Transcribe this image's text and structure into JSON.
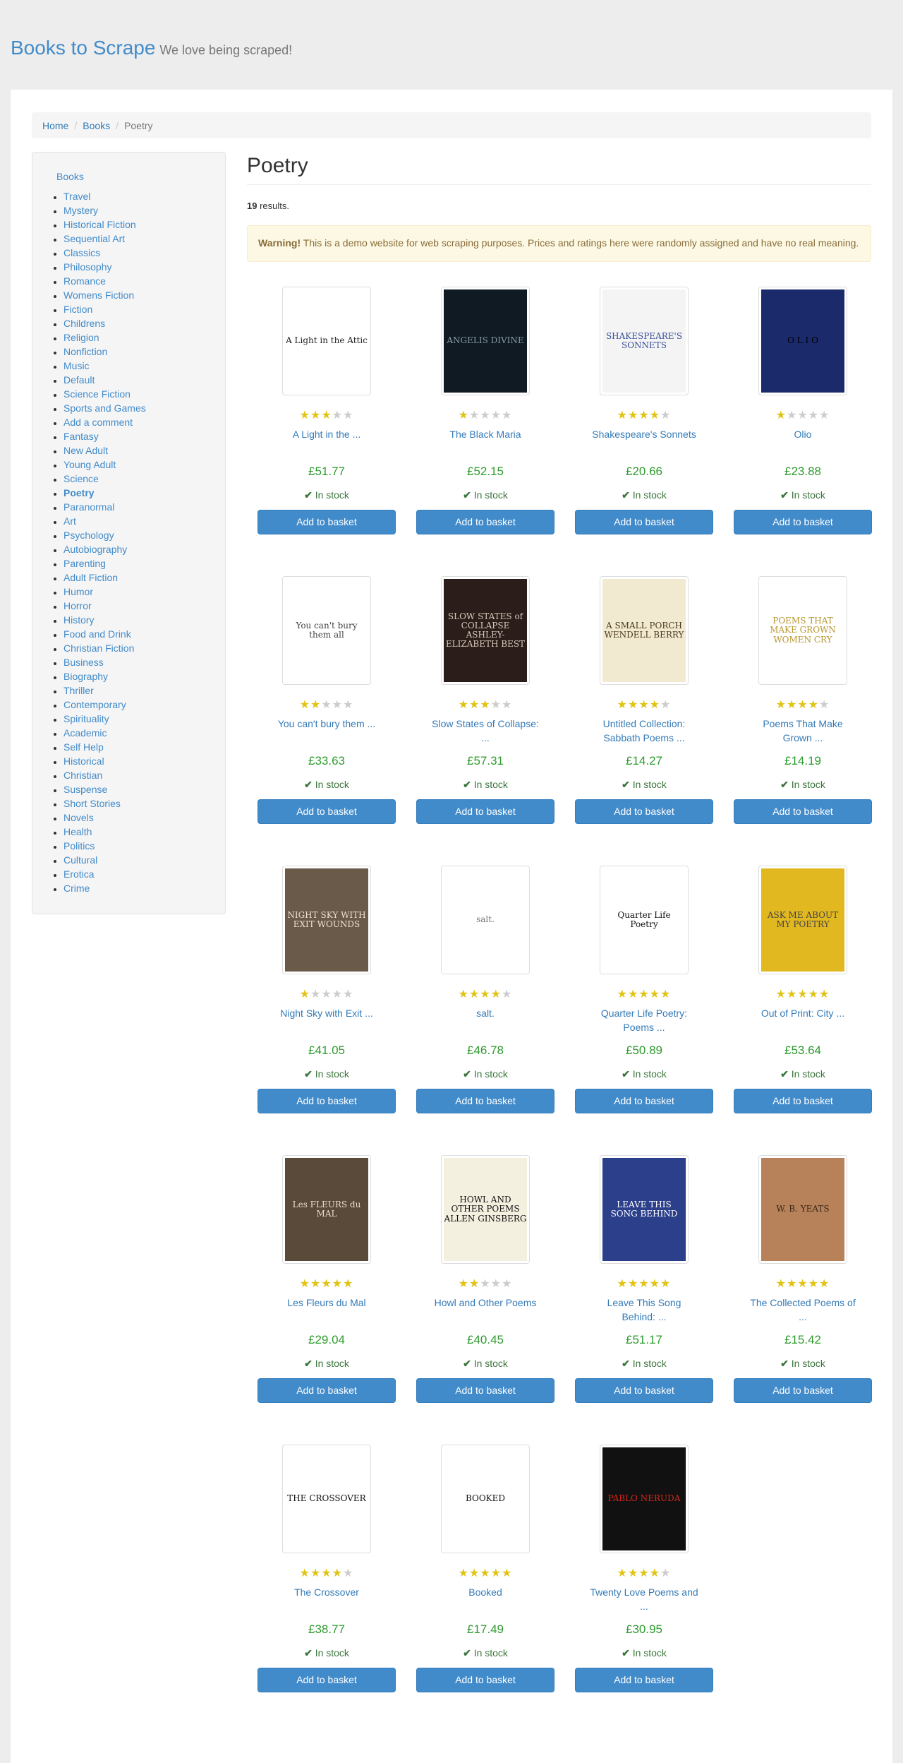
{
  "header": {
    "brand": "Books to Scrape",
    "tagline": "We love being scraped!"
  },
  "breadcrumb": [
    "Home",
    "Books",
    "Poetry"
  ],
  "sidebar": {
    "root": "Books",
    "current": "Poetry",
    "categories": [
      "Travel",
      "Mystery",
      "Historical Fiction",
      "Sequential Art",
      "Classics",
      "Philosophy",
      "Romance",
      "Womens Fiction",
      "Fiction",
      "Childrens",
      "Religion",
      "Nonfiction",
      "Music",
      "Default",
      "Science Fiction",
      "Sports and Games",
      "Add a comment",
      "Fantasy",
      "New Adult",
      "Young Adult",
      "Science",
      "Poetry",
      "Paranormal",
      "Art",
      "Psychology",
      "Autobiography",
      "Parenting",
      "Adult Fiction",
      "Humor",
      "Horror",
      "History",
      "Food and Drink",
      "Christian Fiction",
      "Business",
      "Biography",
      "Thriller",
      "Contemporary",
      "Spirituality",
      "Academic",
      "Self Help",
      "Historical",
      "Christian",
      "Suspense",
      "Short Stories",
      "Novels",
      "Health",
      "Politics",
      "Cultural",
      "Erotica",
      "Crime"
    ]
  },
  "main": {
    "title": "Poetry",
    "result_count": "19",
    "results_suffix": " results.",
    "warning_label": "Warning!",
    "warning_text": " This is a demo website for web scraping purposes. Prices and ratings here were randomly assigned and have no real meaning.",
    "stock_text": "In stock",
    "add_label": "Add to basket"
  },
  "books": [
    {
      "title": "A Light in the ...",
      "price": "£51.77",
      "rating": 3,
      "cover_bg": "#ffffff",
      "cover_fg": "#222222",
      "cover_text": "A Light in the Attic"
    },
    {
      "title": "The Black Maria",
      "price": "£52.15",
      "rating": 1,
      "cover_bg": "#0f1a22",
      "cover_fg": "#8899aa",
      "cover_text": "ANGELIS DIVINE"
    },
    {
      "title": "Shakespeare's Sonnets",
      "price": "£20.66",
      "rating": 4,
      "cover_bg": "#f4f4f4",
      "cover_fg": "#3a4f9a",
      "cover_text": "SHAKESPEARE'S SONNETS"
    },
    {
      "title": "Olio",
      "price": "£23.88",
      "rating": 1,
      "cover_bg": "#1b2a6b",
      "cover_fg": "#000000",
      "cover_text": "O L I O"
    },
    {
      "title": "You can't bury them ...",
      "price": "£33.63",
      "rating": 2,
      "cover_bg": "#ffffff",
      "cover_fg": "#444444",
      "cover_text": "You can't bury them all"
    },
    {
      "title": "Slow States of Collapse: ...",
      "price": "£57.31",
      "rating": 3,
      "cover_bg": "#2a1d1a",
      "cover_fg": "#d8c9b8",
      "cover_text": "SLOW STATES of COLLAPSE ASHLEY-ELIZABETH BEST"
    },
    {
      "title": "Untitled Collection: Sabbath Poems ...",
      "price": "£14.27",
      "rating": 4,
      "cover_bg": "#f2ead0",
      "cover_fg": "#4a3a20",
      "cover_text": "A SMALL PORCH WENDELL BERRY"
    },
    {
      "title": "Poems That Make Grown ...",
      "price": "£14.19",
      "rating": 4,
      "cover_bg": "#ffffff",
      "cover_fg": "#b8962e",
      "cover_text": "POEMS THAT MAKE GROWN WOMEN CRY"
    },
    {
      "title": "Night Sky with Exit ...",
      "price": "£41.05",
      "rating": 1,
      "cover_bg": "#6a5a4a",
      "cover_fg": "#f0e0d0",
      "cover_text": "NIGHT SKY WITH EXIT WOUNDS"
    },
    {
      "title": "salt.",
      "price": "£46.78",
      "rating": 4,
      "cover_bg": "#ffffff",
      "cover_fg": "#777777",
      "cover_text": "salt."
    },
    {
      "title": "Quarter Life Poetry: Poems ...",
      "price": "£50.89",
      "rating": 5,
      "cover_bg": "#ffffff",
      "cover_fg": "#111111",
      "cover_text": "Quarter Life Poetry"
    },
    {
      "title": "Out of Print: City ...",
      "price": "£53.64",
      "rating": 5,
      "cover_bg": "#e2b820",
      "cover_fg": "#444444",
      "cover_text": "ASK ME ABOUT MY POETRY"
    },
    {
      "title": "Les Fleurs du Mal",
      "price": "£29.04",
      "rating": 5,
      "cover_bg": "#5a4a3a",
      "cover_fg": "#e8dcc8",
      "cover_text": "Les FLEURS du MAL"
    },
    {
      "title": "Howl and Other Poems",
      "price": "£40.45",
      "rating": 2,
      "cover_bg": "#f4f0e0",
      "cover_fg": "#111111",
      "cover_text": "HOWL AND OTHER POEMS ALLEN GINSBERG"
    },
    {
      "title": "Leave This Song Behind: ...",
      "price": "£51.17",
      "rating": 5,
      "cover_bg": "#2c3f8a",
      "cover_fg": "#ffffff",
      "cover_text": "LEAVE THIS SONG BEHIND"
    },
    {
      "title": "The Collected Poems of ...",
      "price": "£15.42",
      "rating": 5,
      "cover_bg": "#b7825a",
      "cover_fg": "#3a2818",
      "cover_text": "W. B. YEATS"
    },
    {
      "title": "The Crossover",
      "price": "£38.77",
      "rating": 4,
      "cover_bg": "#ffffff",
      "cover_fg": "#111111",
      "cover_text": "THE CROSSOVER"
    },
    {
      "title": "Booked",
      "price": "£17.49",
      "rating": 5,
      "cover_bg": "#ffffff",
      "cover_fg": "#111111",
      "cover_text": "BOOKED"
    },
    {
      "title": "Twenty Love Poems and ...",
      "price": "£30.95",
      "rating": 4,
      "cover_bg": "#111111",
      "cover_fg": "#d0281e",
      "cover_text": "PABLO NERUDA"
    }
  ]
}
